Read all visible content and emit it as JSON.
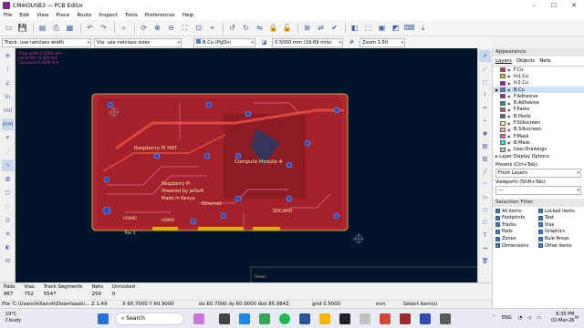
{
  "window": {
    "title": "CM4IOUSB3 — PCB Editor",
    "controls": [
      "–",
      "☐",
      "✕"
    ]
  },
  "menu": [
    "File",
    "Edit",
    "View",
    "Place",
    "Route",
    "Inspect",
    "Tools",
    "Preferences",
    "Help"
  ],
  "toolbar": {
    "icons": [
      "new-board-icon",
      "save-icon",
      "page-settings-icon",
      "print-icon",
      "plot-icon",
      "undo-icon",
      "redo-icon",
      "search-icon",
      "refresh-icon",
      "zoom-in-icon",
      "zoom-out-icon",
      "zoom-fit-icon",
      "zoom-objects-icon",
      "zoom-selection-icon",
      "rotate-ccw-icon",
      "rotate-cw-icon",
      "flip-icon",
      "lock-icon",
      "unlock-icon",
      "netlist-icon",
      "update-pcb-icon",
      "drc-icon",
      "layer-icon",
      "footprint-editor-icon",
      "footprint-browser-icon",
      "3d-viewer-icon",
      "scripting-icon",
      "plugin-icon"
    ]
  },
  "options": {
    "track": "Track: use netclass width",
    "via": "Via: use netclass sizes",
    "layer": "B.Cu (PgDn)",
    "grid": "0.5000 mm (19.69 mils)",
    "zoom": "Zoom 1.50"
  },
  "canvas": {
    "board_labels": [
      "Raspberry Pi HAT",
      "Compute Module 4",
      "Raspberry Pi",
      "Powered by JaiSoft",
      "Made in Kenya",
      "Ethernet",
      "HDMI0",
      "HDMI1",
      "Rev 3",
      "SDCARD"
    ],
    "info_lines": [
      "Track width 0.2500 mm",
      "Via 0.600 / 0.300 mm",
      "Clearance 0.2000 mm"
    ],
    "sheet_label": "Sheet:"
  },
  "panel": {
    "appearance": "Appearance",
    "tabs": [
      "Layers",
      "Objects",
      "Nets"
    ],
    "layers": [
      {
        "name": "F.Cu",
        "color": "#c83434"
      },
      {
        "name": "In1.Cu",
        "color": "#c2c200"
      },
      {
        "name": "In2.Cu",
        "color": "#c200c2"
      },
      {
        "name": "B.Cu",
        "color": "#4d7fc4"
      },
      {
        "name": "F.Adhesive",
        "color": "#8a2f8a"
      },
      {
        "name": "B.Adhesive",
        "color": "#2f8a8a"
      },
      {
        "name": "F.Paste",
        "color": "#b45a5a"
      },
      {
        "name": "B.Paste",
        "color": "#5a5a8a"
      },
      {
        "name": "F.Silkscreen",
        "color": "#f2eda1"
      },
      {
        "name": "B.Silkscreen",
        "color": "#e8b2a7"
      },
      {
        "name": "F.Mask",
        "color": "#d86c95"
      },
      {
        "name": "B.Mask",
        "color": "#02ffee"
      },
      {
        "name": "User.Drawings",
        "color": "#c2c2c2"
      }
    ],
    "active_layer": "B.Cu",
    "layer_display_options": "Layer Display Options",
    "presets_label": "Presets (Ctrl+Tab):",
    "presets_value": "Front Layers",
    "viewports_label": "Viewports (Shift+Tab):",
    "viewports_value": "---",
    "selection_filter": "Selection Filter",
    "filters": [
      "All items",
      "Locked items",
      "Footprints",
      "Text",
      "Tracks",
      "Vias",
      "Pads",
      "Graphics",
      "Zones",
      "Rule Areas",
      "Dimensions",
      "Other items"
    ]
  },
  "status": {
    "labels": [
      "Pads",
      "Vias",
      "Track Segments",
      "Nets",
      "Unrouted"
    ],
    "values": [
      "967",
      "752",
      "5547",
      "259",
      "0"
    ],
    "file": "File 'C:\\Users\\hillarioh\\Downloads\\...",
    "z": "Z 1.49",
    "xy": "X 60.7000  Y 60.9000",
    "dxy": "dx 60.7000  dy 60.9000  dist 85.9843",
    "grid": "grid 0.5000",
    "units": "mm",
    "mode": "Select item(s)"
  },
  "taskbar": {
    "weather_temp": "19°C",
    "weather_desc": "Cloudy",
    "search": "Search",
    "lang": "ENG",
    "time": "6:35 PM",
    "date": "02-Mar-26"
  }
}
